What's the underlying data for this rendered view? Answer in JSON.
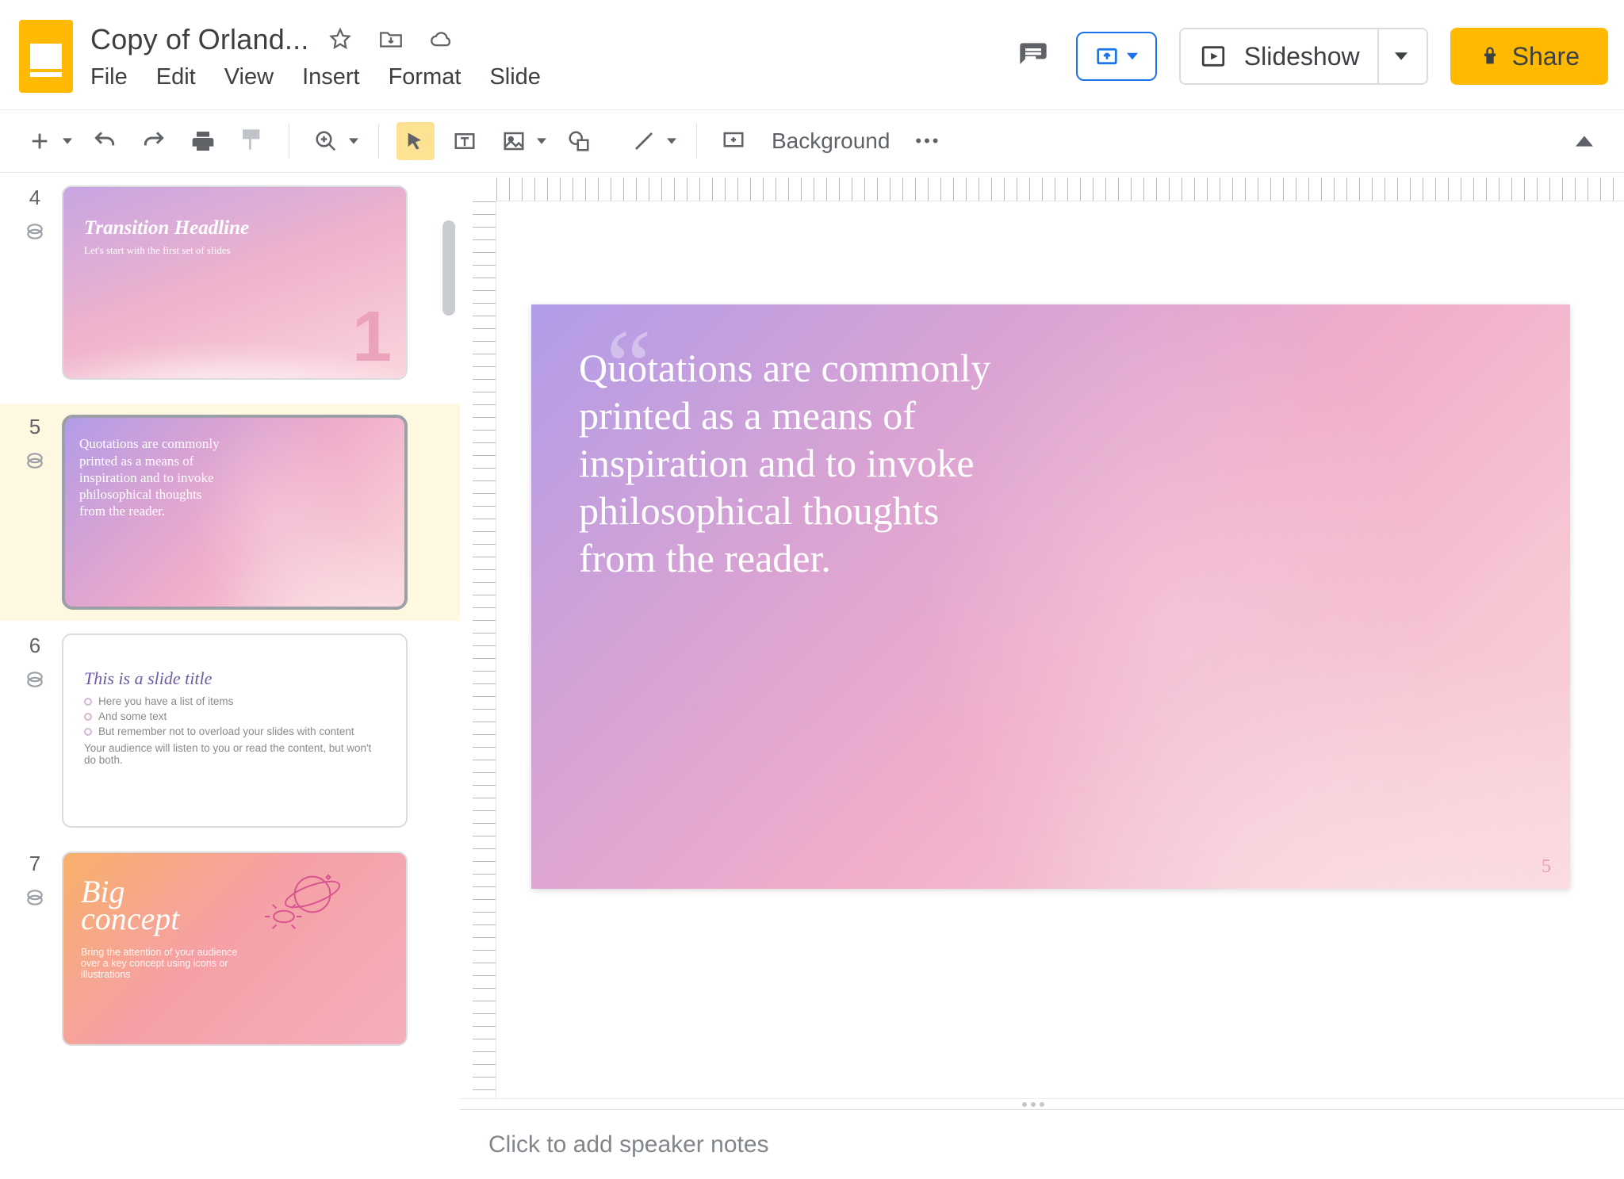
{
  "header": {
    "doc_title": "Copy of Orland...",
    "menus": [
      "File",
      "Edit",
      "View",
      "Insert",
      "Format",
      "Slide"
    ],
    "slideshow_label": "Slideshow",
    "share_label": "Share"
  },
  "toolbar": {
    "background_label": "Background"
  },
  "slides": {
    "current_number_display": "5",
    "main_quote": "Quotations are commonly printed as a means of inspiration and to invoke philosophical thoughts from the reader.",
    "thumbs": [
      {
        "num": "4",
        "title": "Transition Headline",
        "subtitle": "Let's start with the first set of slides",
        "big_num": "1"
      },
      {
        "num": "5",
        "text": "Quotations are commonly printed as a means of inspiration and to invoke philosophical thoughts from the reader."
      },
      {
        "num": "6",
        "title": "This is a slide title",
        "bullets": [
          "Here you have a list of items",
          "And some text",
          "But remember not to overload your slides with content"
        ],
        "footer": "Your audience will listen to you or read the content, but won't do both."
      },
      {
        "num": "7",
        "title_line1": "Big",
        "title_line2": "concept",
        "subtitle": "Bring the attention of your audience over a key concept using icons or illustrations"
      }
    ]
  },
  "speaker_notes_placeholder": "Click to add speaker notes"
}
